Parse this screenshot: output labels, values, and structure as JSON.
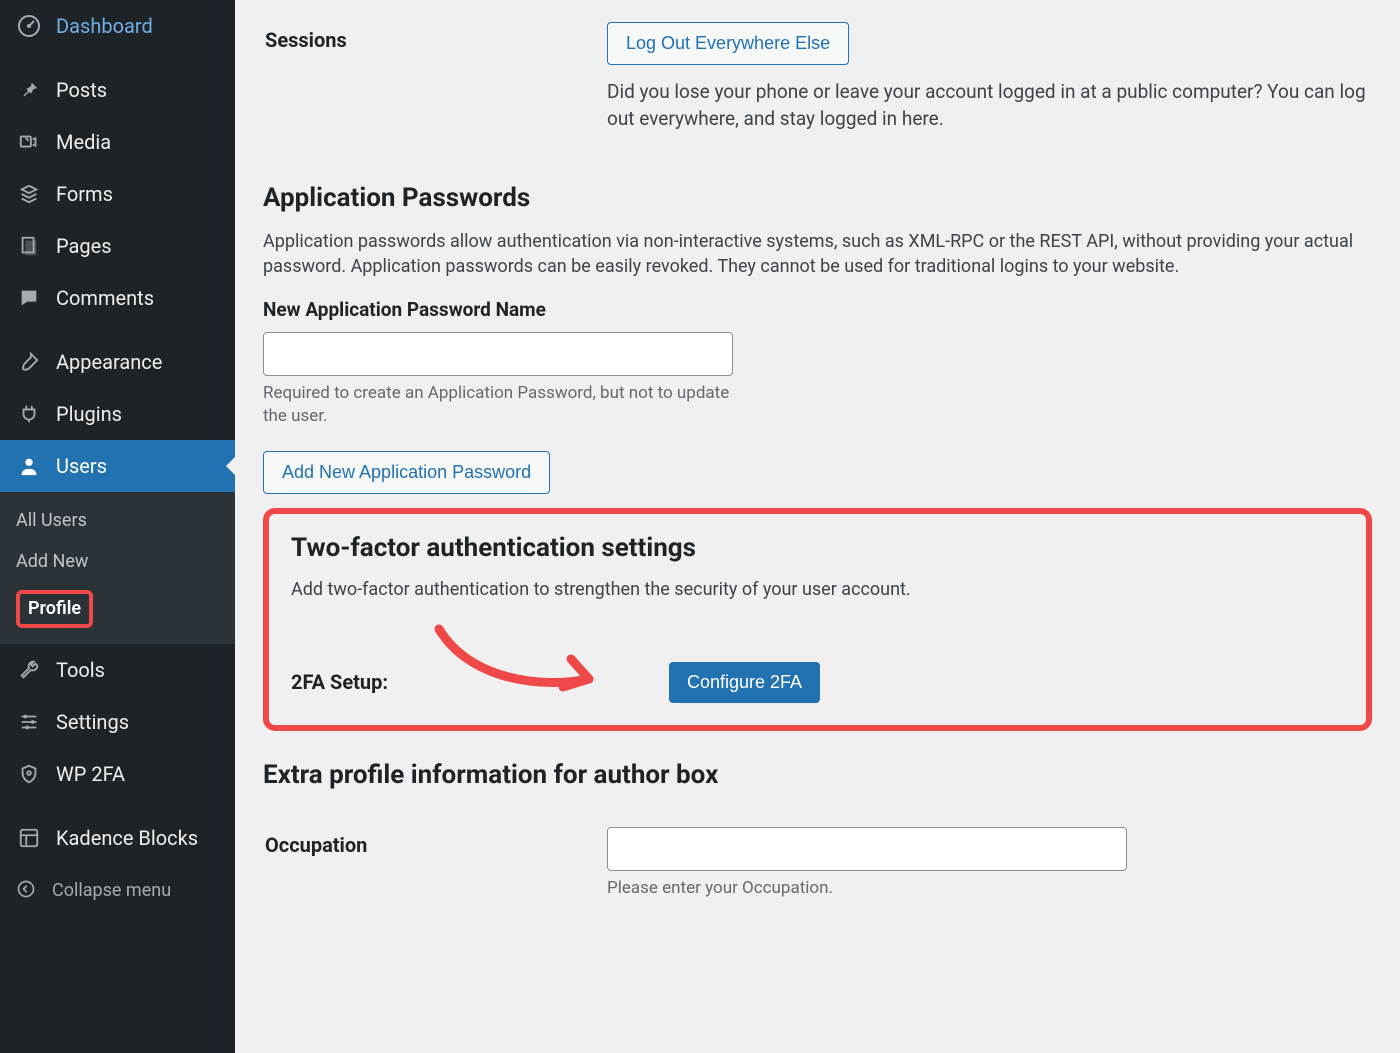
{
  "sidebar": {
    "items": [
      {
        "id": "dashboard",
        "label": "Dashboard",
        "icon": "dashboard-icon"
      },
      {
        "id": "posts",
        "label": "Posts",
        "icon": "pin-icon"
      },
      {
        "id": "media",
        "label": "Media",
        "icon": "media-icon"
      },
      {
        "id": "forms",
        "label": "Forms",
        "icon": "forms-icon"
      },
      {
        "id": "pages",
        "label": "Pages",
        "icon": "pages-icon"
      },
      {
        "id": "comments",
        "label": "Comments",
        "icon": "comment-icon"
      },
      {
        "id": "appearance",
        "label": "Appearance",
        "icon": "brush-icon"
      },
      {
        "id": "plugins",
        "label": "Plugins",
        "icon": "plug-icon"
      },
      {
        "id": "users",
        "label": "Users",
        "icon": "user-icon",
        "active": true
      },
      {
        "id": "tools",
        "label": "Tools",
        "icon": "wrench-icon"
      },
      {
        "id": "settings",
        "label": "Settings",
        "icon": "sliders-icon"
      },
      {
        "id": "wp2fa",
        "label": "WP 2FA",
        "icon": "shield-icon"
      },
      {
        "id": "kadence",
        "label": "Kadence Blocks",
        "icon": "blocks-icon"
      }
    ],
    "users_submenu": [
      {
        "label": "All Users"
      },
      {
        "label": "Add New"
      },
      {
        "label": "Profile",
        "current": true
      }
    ],
    "collapse_label": "Collapse menu"
  },
  "sessions": {
    "th": "Sessions",
    "button": "Log Out Everywhere Else",
    "desc": "Did you lose your phone or leave your account logged in at a public computer? You can log out everywhere, and stay logged in here."
  },
  "app_passwords": {
    "heading": "Application Passwords",
    "desc": "Application passwords allow authentication via non-interactive systems, such as XML-RPC or the REST API, without providing your actual password. Application passwords can be easily revoked. They cannot be used for traditional logins to your website.",
    "field_label": "New Application Password Name",
    "field_value": "",
    "field_hint": "Required to create an Application Password, but not to update the user.",
    "add_button": "Add New Application Password"
  },
  "twofa": {
    "heading": "Two-factor authentication settings",
    "desc": "Add two-factor authentication to strengthen the security of your user account.",
    "setup_label": "2FA Setup:",
    "button": "Configure 2FA"
  },
  "extra": {
    "heading": "Extra profile information for author box",
    "occupation_label": "Occupation",
    "occupation_value": "",
    "occupation_hint": "Please enter your Occupation."
  }
}
